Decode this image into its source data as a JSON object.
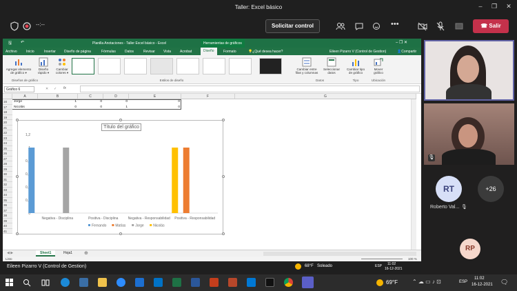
{
  "teams": {
    "window_title": "Taller: Excel básico",
    "call_timer": "--:--",
    "request_control_label": "Solicitar control",
    "leave_label": "Salir",
    "presenter_label": "Eileen Pizarro V (Control de Gestion)",
    "participants": {
      "initials_1": "RT",
      "name_1": "Roberto Val...",
      "overflow_count": "+26",
      "initials_2": "RP"
    }
  },
  "excel": {
    "window_title": "Planilla Anotaciones - Taller Excel básico - Excel",
    "tools_context": "Herramientas de gráficos",
    "user_name": "Eileen Pizarro V (Control de Gestion)",
    "tabs": [
      "Archivo",
      "Inicio",
      "Insertar",
      "Diseño de página",
      "Fórmulas",
      "Datos",
      "Revisar",
      "Vista",
      "Acrobat",
      "Diseño",
      "Formato"
    ],
    "tell_me": "¿Qué desea hacer?",
    "share_label": "Compartir",
    "ribbon": {
      "add_element": "Agregar elemento de gráfico ▾",
      "quick_layout": "Diseño rápido ▾",
      "change_colors": "Cambiar colores ▾",
      "switch_row_col": "Cambiar entre filas y columnas",
      "select_data": "Seleccionar datos",
      "change_type": "Cambiar tipo de gráfico",
      "move_chart": "Mover gráfico",
      "group_layouts": "Diseños de gráfico",
      "group_styles": "Estilos de diseño",
      "group_data": "Datos",
      "group_type": "Tipo",
      "group_location": "Ubicación"
    },
    "name_box": "Gráfico 6",
    "formula_fx": "fx",
    "columns": [
      "A",
      "B",
      "C",
      "D",
      "E",
      "F",
      "G"
    ],
    "rows": [
      "16",
      "17",
      "18",
      "19",
      "20",
      "21",
      "22",
      "23",
      "24",
      "25",
      "26",
      "27",
      "28",
      "29",
      "30",
      "31",
      "32",
      "33",
      "34",
      "35",
      "36",
      "37",
      "38",
      "39",
      "40",
      "41"
    ],
    "data_rows": [
      {
        "name": "Jorge",
        "b": "1",
        "c": "0",
        "d": "0",
        "e": "0"
      },
      {
        "name": "Nicolás",
        "b": "0",
        "c": "0",
        "d": "1",
        "e": "0"
      }
    ],
    "sheets": [
      "Sheet1",
      "Hoja1"
    ],
    "status_text": "Listo",
    "zoom": "100 %"
  },
  "chart_data": {
    "type": "bar",
    "title": "Título del gráfico",
    "categories": [
      "Negativa - Disciplina",
      "Positiva - Disciplina",
      "Negativa - Responsabilidad",
      "Positiva - Responsabilidad"
    ],
    "ylim": [
      0,
      1.2
    ],
    "yticks": [
      "0",
      "0,2",
      "0,4",
      "0,6",
      "0,8",
      "1",
      "1,2"
    ],
    "series": [
      {
        "name": "Fernando",
        "color": "#5b9bd5",
        "values": [
          1,
          0,
          0,
          0
        ]
      },
      {
        "name": "Matías",
        "color": "#ed7d31",
        "values": [
          0,
          0,
          0,
          1
        ]
      },
      {
        "name": "Jorge",
        "color": "#a5a5a5",
        "values": [
          1,
          0,
          0,
          0
        ]
      },
      {
        "name": "Nicolás",
        "color": "#ffc000",
        "values": [
          0,
          0,
          1,
          0
        ]
      }
    ],
    "legend_position": "bottom",
    "grid": false
  },
  "os_taskbar": {
    "weather_left": "68°F",
    "weather_left_text": "Soleado",
    "lang_left": "ESP",
    "time_left": "11:02",
    "date_left": "16-12-2021",
    "weather_right": "69°F",
    "lang_right": "ESP",
    "time_right": "11:02",
    "date_right": "16-12-2021"
  }
}
